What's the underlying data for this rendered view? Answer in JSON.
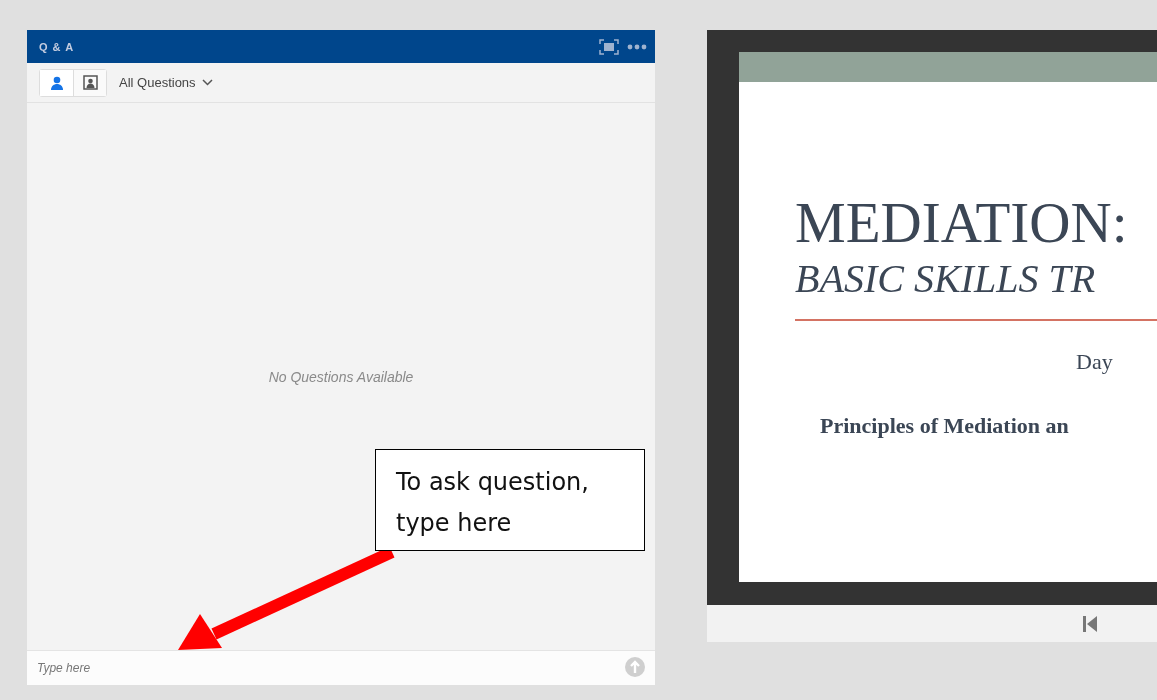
{
  "qa_panel": {
    "title": "Q & A",
    "view_buttons": [
      {
        "kind": "person",
        "selected": true
      },
      {
        "kind": "presenter",
        "selected": false
      }
    ],
    "filter": "All Questions",
    "empty_message": "No Questions Available",
    "input": {
      "placeholder": "Type here"
    }
  },
  "callout": {
    "text": "To ask question, type here"
  },
  "slide": {
    "title": "MEDIATION:",
    "subtitle": "BASIC SKILLS TR",
    "day": "Day",
    "line": "Principles of Mediation an"
  }
}
